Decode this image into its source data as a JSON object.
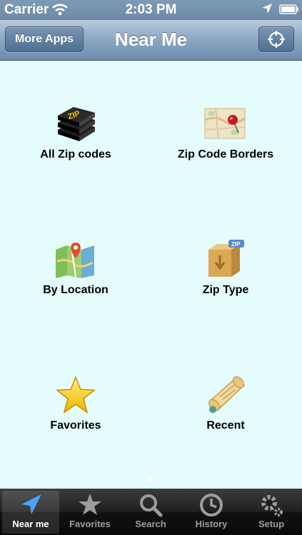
{
  "status_bar": {
    "carrier": "Carrier",
    "time": "2:03 PM"
  },
  "nav_bar": {
    "left_button": "More Apps",
    "title": "Near Me",
    "right_button_icon": "crosshair-icon"
  },
  "grid": [
    {
      "label": "All Zip codes",
      "icon": "zip-stack-icon"
    },
    {
      "label": "Zip Code Borders",
      "icon": "map-pin-icon"
    },
    {
      "label": "By Location",
      "icon": "location-map-icon"
    },
    {
      "label": "Zip Type",
      "icon": "zip-box-icon"
    },
    {
      "label": "Favorites",
      "icon": "star-icon"
    },
    {
      "label": "Recent",
      "icon": "scroll-icon"
    }
  ],
  "tab_bar": {
    "tabs": [
      {
        "label": "Near me",
        "icon": "navigation-arrow-icon",
        "active": true
      },
      {
        "label": "Favorites",
        "icon": "star-icon",
        "active": false
      },
      {
        "label": "Search",
        "icon": "magnifier-icon",
        "active": false
      },
      {
        "label": "History",
        "icon": "clock-icon",
        "active": false
      },
      {
        "label": "Setup",
        "icon": "gear-icon",
        "active": false
      }
    ]
  },
  "colors": {
    "background": "#e4fcfc",
    "nav_bar": "#8aa6c1",
    "tab_bar": "#111111"
  }
}
